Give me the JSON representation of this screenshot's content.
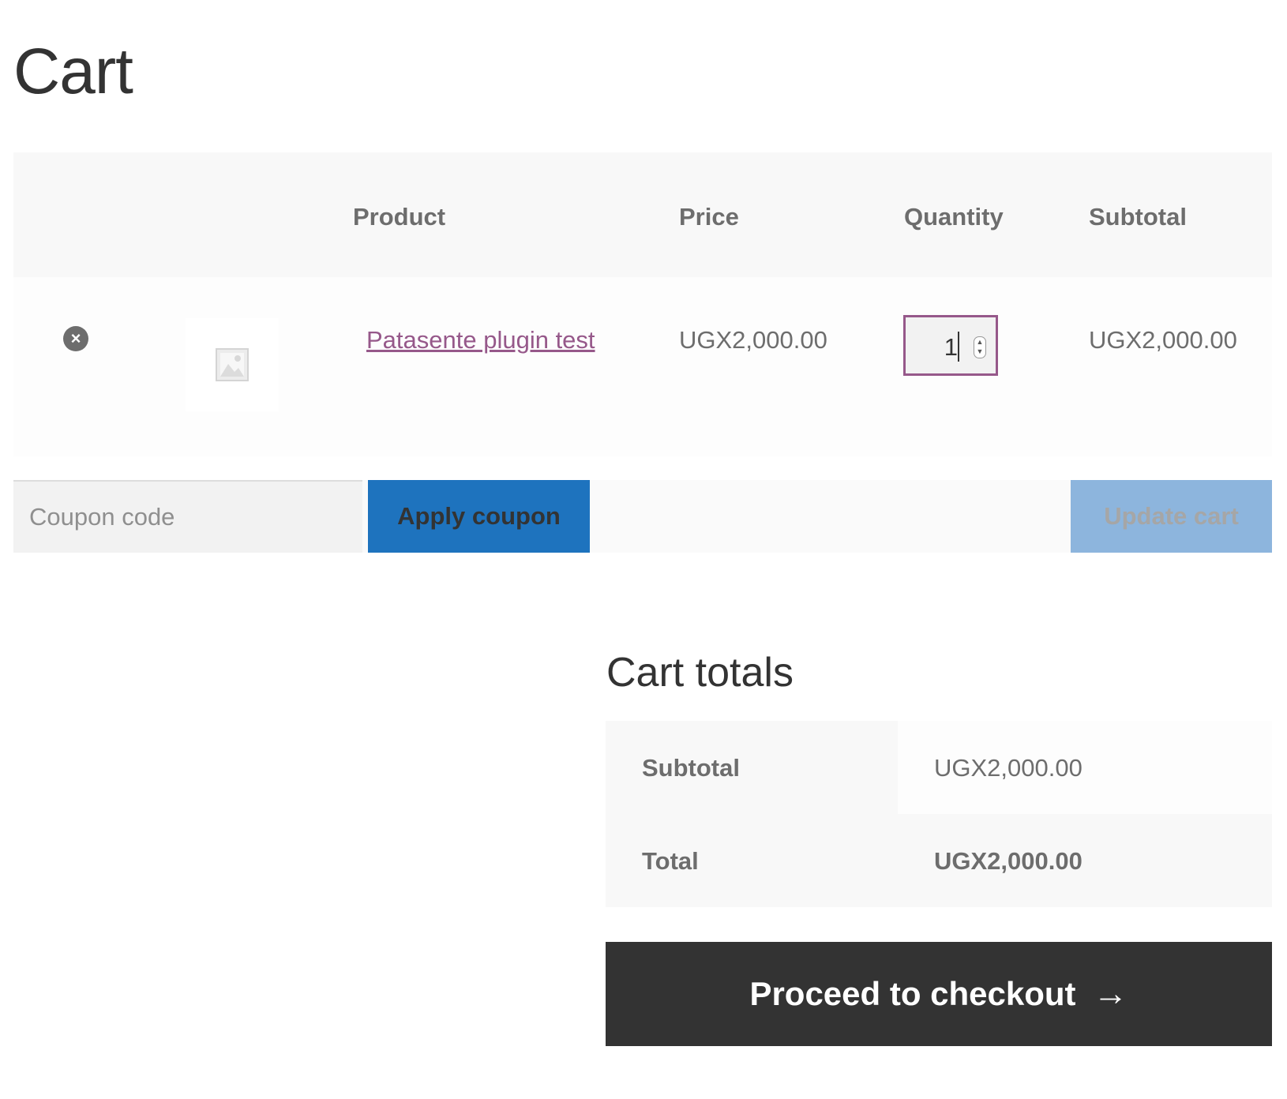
{
  "page": {
    "title": "Cart"
  },
  "cart_table": {
    "headers": {
      "product": "Product",
      "price": "Price",
      "quantity": "Quantity",
      "subtotal": "Subtotal"
    },
    "items": [
      {
        "remove_icon": "close-circle-icon",
        "thumbnail_icon": "image-placeholder-icon",
        "name": "Patasente plugin test",
        "price": "UGX2,000.00",
        "quantity": "1",
        "subtotal": "UGX2,000.00"
      }
    ]
  },
  "actions": {
    "coupon_placeholder": "Coupon code",
    "apply_coupon_label": "Apply coupon",
    "update_cart_label": "Update cart"
  },
  "cart_totals": {
    "title": "Cart totals",
    "subtotal_label": "Subtotal",
    "subtotal_value": "UGX2,000.00",
    "total_label": "Total",
    "total_value": "UGX2,000.00"
  },
  "checkout": {
    "label": "Proceed to checkout",
    "arrow_icon": "arrow-right-icon"
  },
  "colors": {
    "link": "#96588a",
    "apply_button": "#1e73be",
    "update_button_disabled": "#8db5dd",
    "checkout_button": "#333333"
  }
}
